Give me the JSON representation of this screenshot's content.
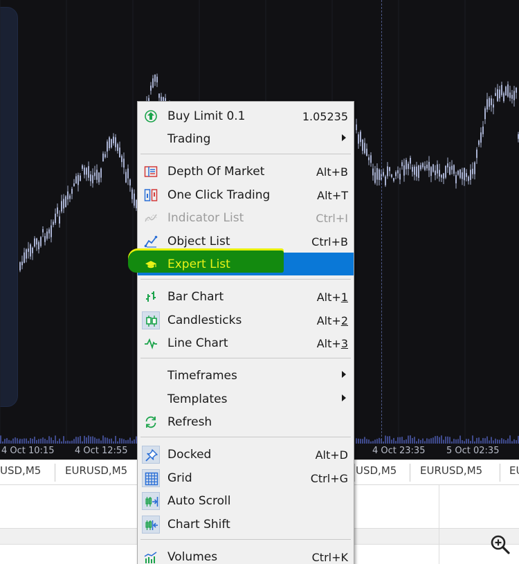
{
  "chart": {
    "timeLabels": [
      "4 Oct 10:15",
      "4 Oct 12:55",
      "4 Oct 23:35",
      "5 Oct 02:35"
    ],
    "background": "#111114",
    "candleColor": "#a9b2d2"
  },
  "tabs": [
    "USD,M5",
    "EURUSD,M5",
    "USD,M5",
    "EURUSD,M5",
    "EU"
  ],
  "menu": {
    "items": [
      {
        "id": "buy-limit",
        "label": "Buy Limit 0.1",
        "shortcut": "1.05235",
        "icon": "buy-limit-icon"
      },
      {
        "id": "trading",
        "label": "Trading",
        "submenu": true
      },
      {
        "id": "depth-of-market",
        "label": "Depth Of Market",
        "shortcut": "Alt+B",
        "icon": "depth-of-market-icon"
      },
      {
        "id": "one-click-trading",
        "label": "One Click Trading",
        "shortcut": "Alt+T",
        "icon": "one-click-trading-icon"
      },
      {
        "id": "indicator-list",
        "label": "Indicator List",
        "shortcut": "Ctrl+I",
        "icon": "indicator-list-icon",
        "disabled": true
      },
      {
        "id": "object-list",
        "label": "Object List",
        "shortcut": "Ctrl+B",
        "icon": "object-list-icon"
      },
      {
        "id": "expert-list",
        "label": "Expert List",
        "icon": "expert-list-icon",
        "highlighted": true
      },
      {
        "id": "bar-chart",
        "label": "Bar Chart",
        "shortcutPrefix": "Alt+",
        "shortcutKey": "1",
        "icon": "bar-chart-icon"
      },
      {
        "id": "candlesticks",
        "label": "Candlesticks",
        "shortcutPrefix": "Alt+",
        "shortcutKey": "2",
        "icon": "candlesticks-icon",
        "checked": true
      },
      {
        "id": "line-chart",
        "label": "Line Chart",
        "shortcutPrefix": "Alt+",
        "shortcutKey": "3",
        "icon": "line-chart-icon"
      },
      {
        "id": "timeframes",
        "label": "Timeframes",
        "submenu": true
      },
      {
        "id": "templates",
        "label": "Templates",
        "submenu": true
      },
      {
        "id": "refresh",
        "label": "Refresh",
        "icon": "refresh-icon"
      },
      {
        "id": "docked",
        "label": "Docked",
        "shortcut": "Alt+D",
        "icon": "docked-icon",
        "checked": true
      },
      {
        "id": "grid",
        "label": "Grid",
        "shortcut": "Ctrl+G",
        "icon": "grid-icon",
        "checked": true
      },
      {
        "id": "auto-scroll",
        "label": "Auto Scroll",
        "icon": "auto-scroll-icon",
        "checked": true
      },
      {
        "id": "chart-shift",
        "label": "Chart Shift",
        "icon": "chart-shift-icon",
        "checked": true
      },
      {
        "id": "volumes",
        "label": "Volumes",
        "shortcut": "Ctrl+K",
        "icon": "volumes-icon"
      }
    ],
    "highlightColor": "#0a78d7",
    "markerColor": "#138a0f"
  }
}
